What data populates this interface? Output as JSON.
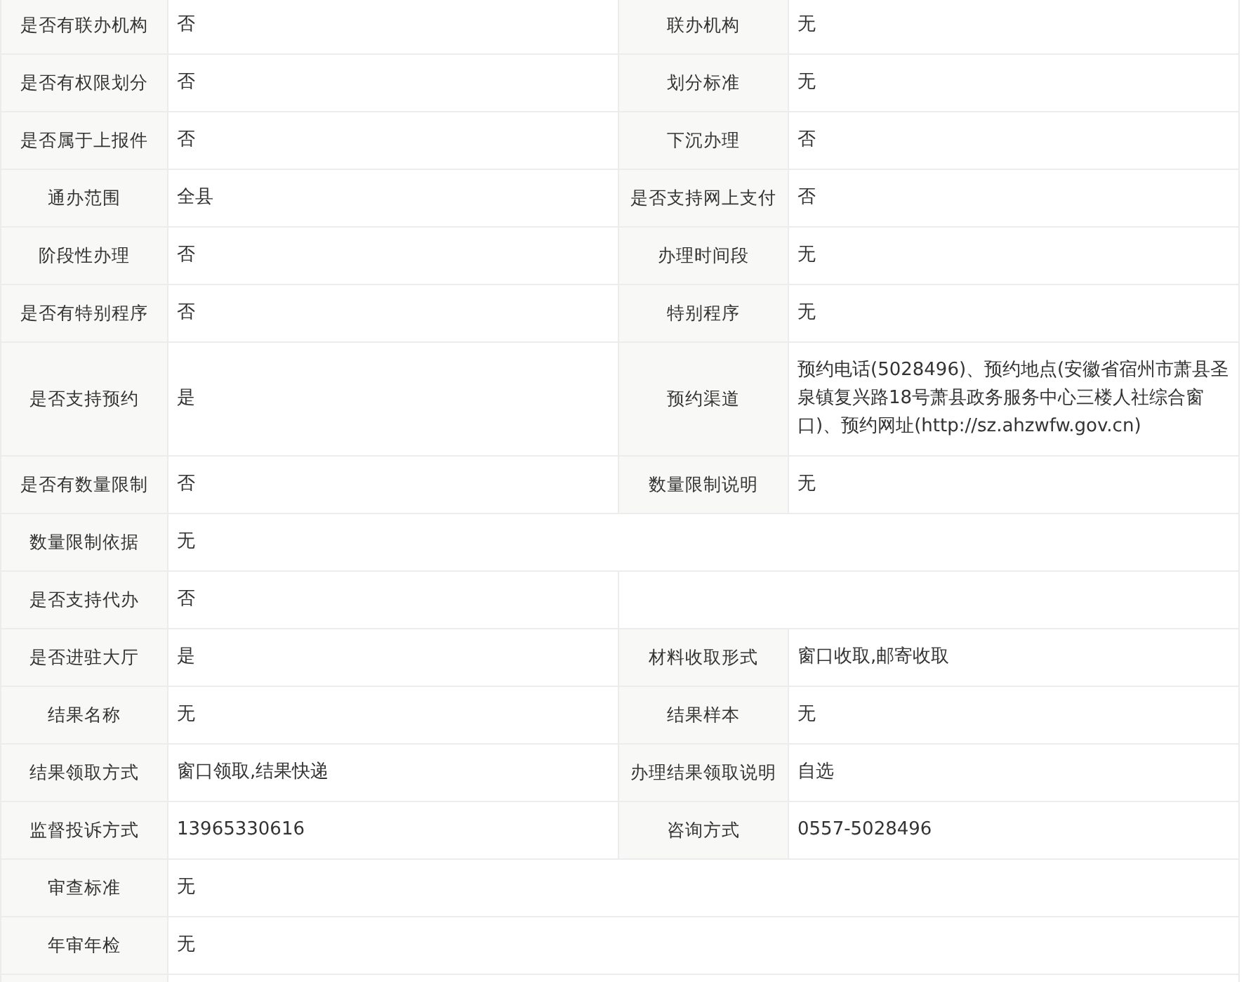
{
  "rows": [
    {
      "kind": "pair",
      "items": [
        {
          "label": "是否有联办机构",
          "value": "否"
        },
        {
          "label": "联办机构",
          "value": "无"
        }
      ]
    },
    {
      "kind": "pair",
      "items": [
        {
          "label": "是否有权限划分",
          "value": "否"
        },
        {
          "label": "划分标准",
          "value": "无"
        }
      ]
    },
    {
      "kind": "pair",
      "items": [
        {
          "label": "是否属于上报件",
          "value": "否"
        },
        {
          "label": "下沉办理",
          "value": "否"
        }
      ]
    },
    {
      "kind": "pair",
      "items": [
        {
          "label": "通办范围",
          "value": "全县"
        },
        {
          "label": "是否支持网上支付",
          "value": "否"
        }
      ]
    },
    {
      "kind": "pair",
      "items": [
        {
          "label": "阶段性办理",
          "value": "否"
        },
        {
          "label": "办理时间段",
          "value": "无"
        }
      ]
    },
    {
      "kind": "pair",
      "items": [
        {
          "label": "是否有特别程序",
          "value": "否"
        },
        {
          "label": "特别程序",
          "value": "无"
        }
      ]
    },
    {
      "kind": "pair",
      "items": [
        {
          "label": "是否支持预约",
          "value": "是"
        },
        {
          "label": "预约渠道",
          "value": "预约电话(5028496)、预约地点(安徽省宿州市萧县圣泉镇复兴路18号萧县政务服务中心三楼人社综合窗口)、预约网址(http://sz.ahzwfw.gov.cn)"
        }
      ]
    },
    {
      "kind": "pair",
      "items": [
        {
          "label": "是否有数量限制",
          "value": "否"
        },
        {
          "label": "数量限制说明",
          "value": "无"
        }
      ]
    },
    {
      "kind": "wide",
      "items": [
        {
          "label": "数量限制依据",
          "value": "无"
        }
      ]
    },
    {
      "kind": "half",
      "items": [
        {
          "label": "是否支持代办",
          "value": "否"
        }
      ]
    },
    {
      "kind": "pair",
      "items": [
        {
          "label": "是否进驻大厅",
          "value": "是"
        },
        {
          "label": "材料收取形式",
          "value": "窗口收取,邮寄收取"
        }
      ]
    },
    {
      "kind": "pair",
      "items": [
        {
          "label": "结果名称",
          "value": "无"
        },
        {
          "label": "结果样本",
          "value": "无"
        }
      ]
    },
    {
      "kind": "pair",
      "items": [
        {
          "label": "结果领取方式",
          "value": "窗口领取,结果快递"
        },
        {
          "label": "办理结果领取说明",
          "value": "自选"
        }
      ]
    },
    {
      "kind": "pair",
      "items": [
        {
          "label": "监督投诉方式",
          "value": "13965330616"
        },
        {
          "label": "咨询方式",
          "value": "0557-5028496"
        }
      ]
    },
    {
      "kind": "wide",
      "items": [
        {
          "label": "审查标准",
          "value": "无"
        }
      ]
    },
    {
      "kind": "wide",
      "items": [
        {
          "label": "年审年检",
          "value": "无"
        }
      ]
    }
  ]
}
